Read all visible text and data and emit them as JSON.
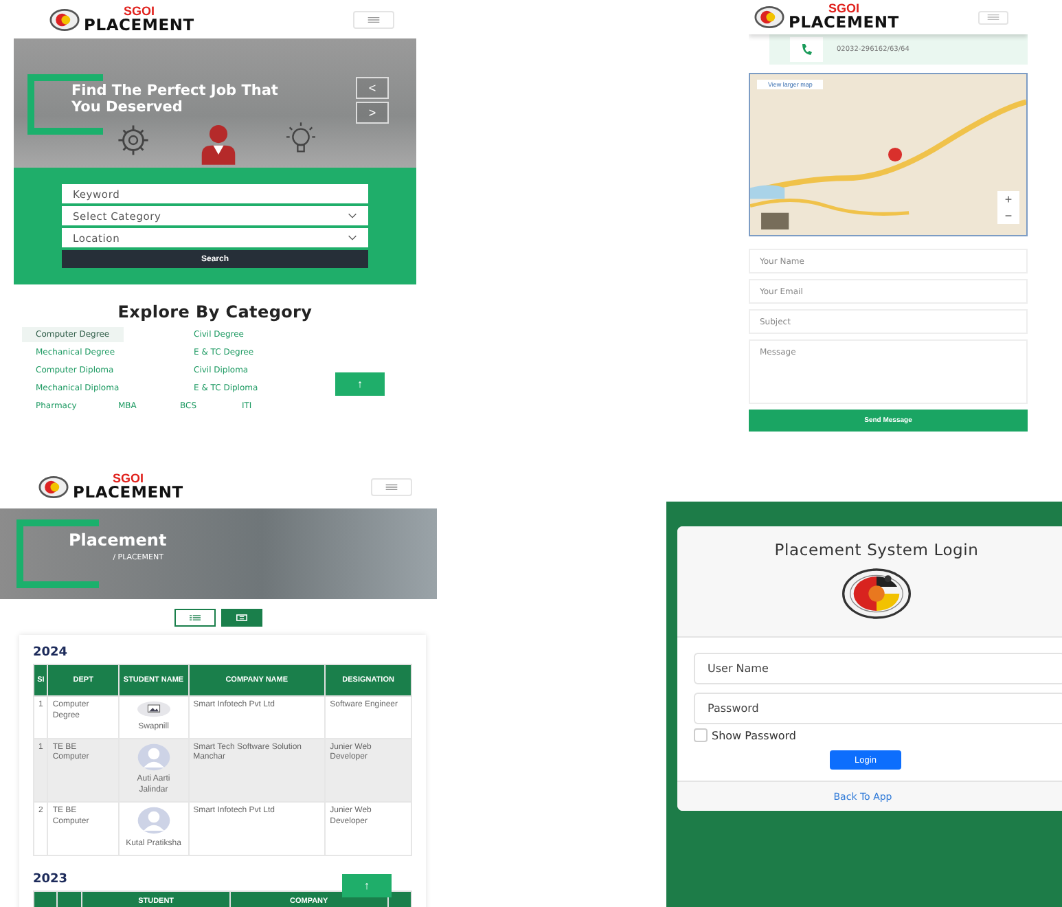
{
  "home_screen": {
    "header": {
      "logo_top": "SGOI",
      "logo_bottom": "PLACEMENT"
    },
    "hero": {
      "title": "Find The Perfect Job That You Deserved",
      "prev": "<",
      "next": ">"
    },
    "search": {
      "keyword_placeholder": "Keyword",
      "category_placeholder": "Select Category",
      "location_placeholder": "Location",
      "button": "Search"
    },
    "categories": {
      "title": "Explore By Category",
      "rows": [
        [
          {
            "label": "Computer Degree",
            "selected": true
          },
          {
            "label": "Civil Degree",
            "selected": false
          }
        ],
        [
          {
            "label": "Mechanical Degree",
            "selected": false
          },
          {
            "label": "E & TC Degree",
            "selected": false
          }
        ],
        [
          {
            "label": "Computer Diploma",
            "selected": false
          },
          {
            "label": "Civil Diploma",
            "selected": false
          }
        ],
        [
          {
            "label": "Mechanical Diploma",
            "selected": false
          },
          {
            "label": "E & TC Diploma",
            "selected": false
          }
        ],
        [
          {
            "label": "Pharmacy",
            "selected": false
          },
          {
            "label": "MBA",
            "selected": false
          },
          {
            "label": "BCS",
            "selected": false
          },
          {
            "label": "ITI",
            "selected": false
          }
        ]
      ]
    },
    "top_button": "↑"
  },
  "contact_screen": {
    "header": {
      "logo_top": "SGOI",
      "logo_bottom": "PLACEMENT"
    },
    "phone": "02032-296162/63/64",
    "map": {
      "larger_map_link": "View larger map",
      "zoom_in": "+",
      "zoom_out": "−"
    },
    "form": {
      "name_placeholder": "Your Name",
      "email_placeholder": "Your Email",
      "subject_placeholder": "Subject",
      "message_placeholder": "Message",
      "button": "Send Message"
    }
  },
  "placement_screen": {
    "header": {
      "logo_top": "SGOI",
      "logo_bottom": "PLACEMENT"
    },
    "banner": {
      "title": "Placement",
      "breadcrumb": "/ PLACEMENT"
    },
    "view_toggles": [
      {
        "kind": "list",
        "selected": false
      },
      {
        "kind": "grid",
        "selected": true
      }
    ],
    "year_tables": [
      {
        "year": "2024",
        "columns": [
          "SI",
          "DEPT",
          "STUDENT NAME",
          "COMPANY NAME",
          "DESIGNATION"
        ],
        "rows": [
          {
            "si": "1",
            "dept": "Computer Degree",
            "kind": "image",
            "student": "Swapnill",
            "company": "Smart Infotech Pvt Ltd",
            "designation": "Software Engineer"
          },
          {
            "si": "1",
            "dept": "TE BE Computer",
            "kind": "avatar",
            "student": "Auti Aarti Jalindar",
            "company": "Smart Tech Software Solution Manchar",
            "designation": "Junier Web Developer"
          },
          {
            "si": "2",
            "dept": "TE BE Computer",
            "kind": "avatar",
            "student": "Kutal Pratiksha",
            "company": "Smart Infotech Pvt Ltd",
            "designation": "Junier Web Developer"
          }
        ]
      }
    ],
    "cut_table": {
      "year": "2023",
      "column_3": "STUDENT",
      "column_4": "COMPANY"
    },
    "top_button": "↑"
  },
  "login_screen": {
    "title": "Placement System Login",
    "username_placeholder": "User Name",
    "password_placeholder": "Password",
    "show_password": {
      "label": "Show Password",
      "checked": false
    },
    "button": "Login",
    "back_link": "Back To App"
  }
}
